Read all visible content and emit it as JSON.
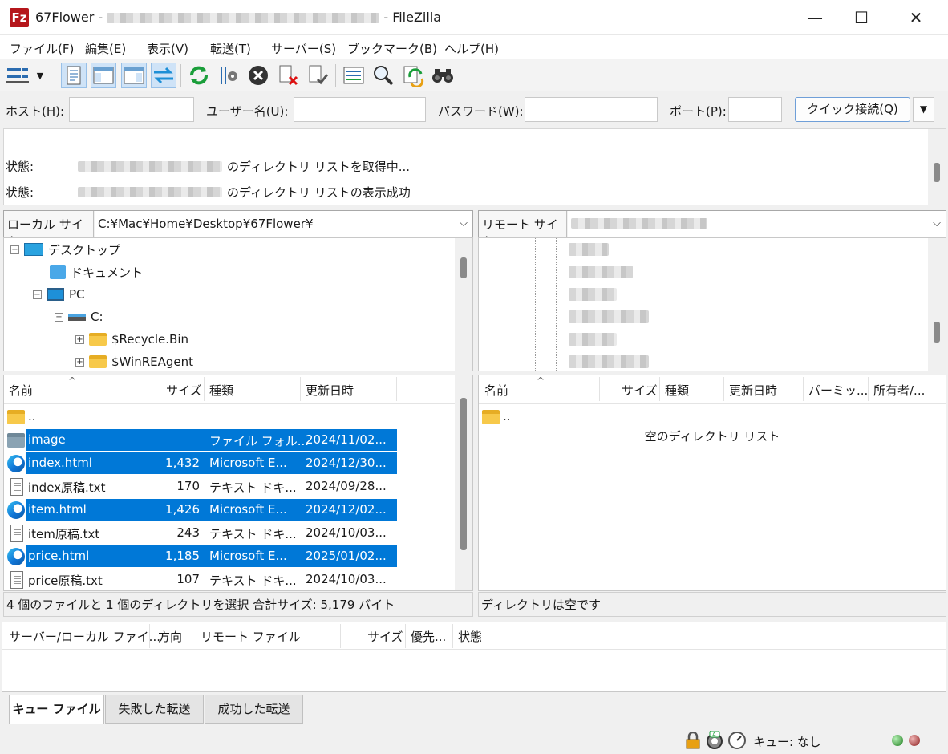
{
  "window": {
    "title_prefix": "67Flower - ",
    "title_suffix": " - FileZilla",
    "app_icon_text": "Fz",
    "minimize": "—",
    "maximize": "☐",
    "close": "✕"
  },
  "menu": [
    "ファイル(F)",
    "編集(E)",
    "表示(V)",
    "転送(T)",
    "サーバー(S)",
    "ブックマーク(B)",
    "ヘルプ(H)"
  ],
  "quickconnect": {
    "host_label": "ホスト(H):",
    "user_label": "ユーザー名(U):",
    "pass_label": "パスワード(W):",
    "port_label": "ポート(P):",
    "host_value": "",
    "user_value": "",
    "pass_value": "",
    "port_value": "",
    "connect_button": "クイック接続(Q)",
    "dropdown": "▼"
  },
  "log": [
    {
      "label": "状態:",
      "text": "のディレクトリ リストを取得中..."
    },
    {
      "label": "状態:",
      "text": "のディレクトリ リストの表示成功"
    }
  ],
  "local": {
    "site_label": "ローカル サイト:",
    "path": "C:¥Mac¥Home¥Desktop¥67Flower¥",
    "tree": [
      "デスクトップ",
      "ドキュメント",
      "PC",
      "C:",
      "$Recycle.Bin",
      "$WinREAgent"
    ],
    "columns": [
      "名前",
      "サイズ",
      "種類",
      "更新日時"
    ],
    "files": [
      {
        "name": "..",
        "size": "",
        "type": "",
        "date": "",
        "icon": "folder",
        "selected": false
      },
      {
        "name": "image",
        "size": "",
        "type": "ファイル フォル...",
        "date": "2024/11/02...",
        "icon": "folder",
        "selected": true
      },
      {
        "name": "index.html",
        "size": "1,432",
        "type": "Microsoft E...",
        "date": "2024/12/30...",
        "icon": "edge",
        "selected": true
      },
      {
        "name": "index原稿.txt",
        "size": "170",
        "type": "テキスト ドキ...",
        "date": "2024/09/28...",
        "icon": "text",
        "selected": false
      },
      {
        "name": "item.html",
        "size": "1,426",
        "type": "Microsoft E...",
        "date": "2024/12/02...",
        "icon": "edge",
        "selected": true
      },
      {
        "name": "item原稿.txt",
        "size": "243",
        "type": "テキスト ドキ...",
        "date": "2024/10/03...",
        "icon": "text",
        "selected": false
      },
      {
        "name": "price.html",
        "size": "1,185",
        "type": "Microsoft E...",
        "date": "2025/01/02...",
        "icon": "edge",
        "selected": true
      },
      {
        "name": "price原稿.txt",
        "size": "107",
        "type": "テキスト ドキ...",
        "date": "2024/10/03...",
        "icon": "text",
        "selected": false
      }
    ],
    "status": "4 個のファイルと 1 個のディレクトリを選択 合計サイズ: 5,179 バイト"
  },
  "remote": {
    "site_label": "リモート サイト:",
    "path": "",
    "columns": [
      "名前",
      "サイズ",
      "種類",
      "更新日時",
      "パーミッ...",
      "所有者/..."
    ],
    "parent": "..",
    "empty_message": "空のディレクトリ リスト",
    "status": "ディレクトリは空です"
  },
  "queue": {
    "columns": [
      "サーバー/ローカル ファイ...",
      "方向",
      "リモート ファイル",
      "サイズ",
      "優先...",
      "状態"
    ],
    "tabs": [
      "キュー ファイル",
      "失敗した転送",
      "成功した転送"
    ]
  },
  "statusbar": {
    "queue_text": "キュー: なし"
  },
  "toolbar_icons": [
    "site-manager-icon",
    "dropdown-arrow-icon",
    "message-log-icon",
    "local-tree-icon",
    "remote-tree-icon",
    "transfer-queue-icon",
    "refresh-icon",
    "process-queue-icon",
    "cancel-icon",
    "disconnect-icon",
    "reconnect-icon",
    "directory-listing-filter-icon",
    "toggle-compare-icon",
    "sync-browse-icon",
    "search-icon"
  ]
}
